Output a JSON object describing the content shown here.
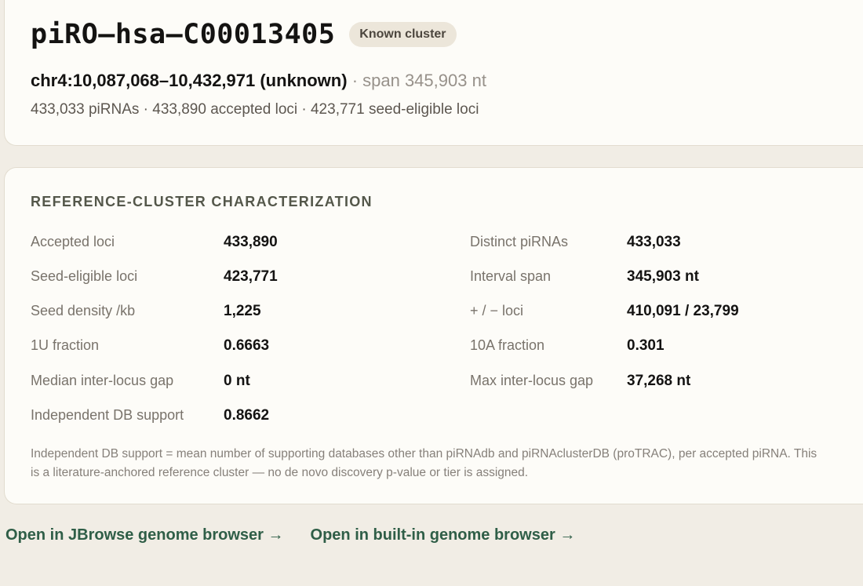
{
  "header": {
    "cluster_id": "piRO–hsa–C00013405",
    "badge": "Known cluster",
    "location": "chr4:10,087,068–10,432,971 (unknown)",
    "span_text": "· span 345,903 nt",
    "counts": "433,033 piRNAs · 433,890 accepted loci · 423,771 seed-eligible loci"
  },
  "characterization": {
    "title": "REFERENCE-CLUSTER CHARACTERIZATION",
    "left": [
      {
        "label": "Accepted loci",
        "value": "433,890"
      },
      {
        "label": "Seed-eligible loci",
        "value": "423,771"
      },
      {
        "label": "Seed density /kb",
        "value": "1,225"
      },
      {
        "label": "1U fraction",
        "value": "0.6663"
      },
      {
        "label": "Median inter-locus gap",
        "value": "0 nt"
      },
      {
        "label": "Independent DB support",
        "value": "0.8662"
      }
    ],
    "right": [
      {
        "label": "Distinct piRNAs",
        "value": "433,033"
      },
      {
        "label": "Interval span",
        "value": "345,903 nt"
      },
      {
        "label": "+ / − loci",
        "value": "410,091 / 23,799"
      },
      {
        "label": "10A fraction",
        "value": "0.301"
      },
      {
        "label": "Max inter-locus gap",
        "value": "37,268 nt"
      }
    ],
    "footnote": "Independent DB support = mean number of supporting databases other than piRNAdb and piRNAclusterDB (proTRAC), per accepted piRNA. This is a literature-anchored reference cluster — no de novo discovery p-value or tier is assigned."
  },
  "links": {
    "jbrowse": "Open in JBrowse genome browser →",
    "builtin": "Open in built-in genome browser →"
  }
}
